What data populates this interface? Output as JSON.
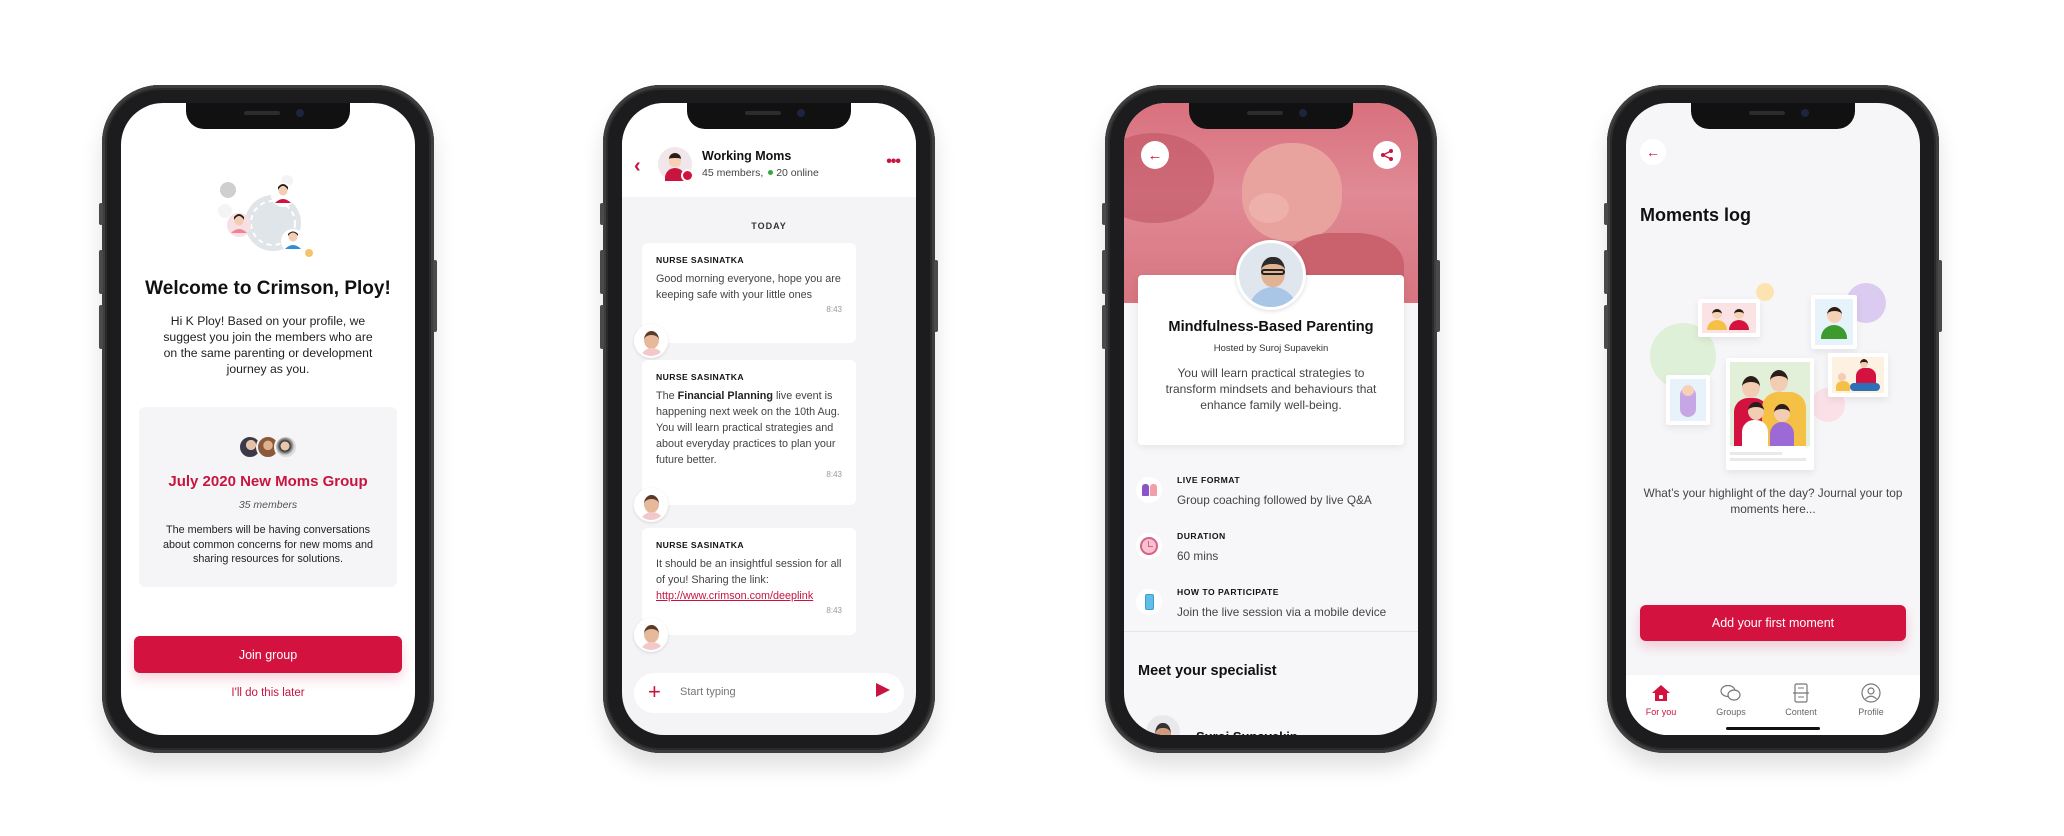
{
  "colors": {
    "accent": "#d3123f",
    "text_dark": "#111111",
    "text_body": "#444444",
    "screen_bg_light": "#f6f6f8",
    "online": "#3aa53a"
  },
  "phone1": {
    "title": "Welcome to Crimson, Ploy!",
    "subtitle": "Hi K Ploy! Based on your profile, we suggest you join the members who are on the same parenting or development journey as you.",
    "group_card": {
      "name": "July 2020 New Moms Group",
      "members": "35 members",
      "description": "The members will be having conversations about common concerns for new moms and sharing resources for solutions."
    },
    "join_button": "Join group",
    "later_link": "I'll do this later"
  },
  "phone2": {
    "group_name": "Working Moms",
    "members": "45 members,",
    "online": "20 online",
    "day_label": "TODAY",
    "messages": [
      {
        "sender": "NURSE SASINATKA",
        "text": "Good morning everyone, hope you are keeping safe with your little ones",
        "time": "8:43"
      },
      {
        "sender": "NURSE SASINATKA",
        "text_before": "The ",
        "text_bold": "Financial Planning",
        "text_after": " live event is happening next week on the 10th Aug. You will learn practical strategies and about everyday practices to plan your future better.",
        "time": "8:43"
      },
      {
        "sender": "NURSE SASINATKA",
        "text": "It should be an insightful session for all of you! Sharing the link:",
        "link": "http://www.crimson.com/deeplink",
        "time": "8:43"
      }
    ],
    "composer_placeholder": "Start typing",
    "icons": {
      "back": "chevron-left",
      "more": "more-horizontal",
      "add": "plus",
      "send": "send"
    }
  },
  "phone3": {
    "event_title": "Mindfulness-Based Parenting",
    "host": "Hosted by Suroj Supavekin",
    "description": "You will learn practical strategies to transform mindsets and behaviours that enhance family well-being.",
    "details": [
      {
        "icon": "people-icon",
        "label": "LIVE FORMAT",
        "value": "Group coaching followed by live Q&A"
      },
      {
        "icon": "clock-icon",
        "label": "DURATION",
        "value": "60 mins"
      },
      {
        "icon": "mobile-icon",
        "label": "HOW TO PARTICIPATE",
        "value": "Join the live session via a mobile device"
      }
    ],
    "section_title": "Meet your specialist",
    "specialist_name": "Suroj Supavekin",
    "icons": {
      "back": "arrow-left",
      "share": "share"
    }
  },
  "phone4": {
    "title": "Moments log",
    "description": "What’s your highlight of the day?  Journal your top moments here...",
    "add_button": "Add your first moment",
    "tabs": [
      {
        "label": "For you",
        "icon": "home-icon",
        "active": true
      },
      {
        "label": "Groups",
        "icon": "chat-bubbles-icon",
        "active": false
      },
      {
        "label": "Content",
        "icon": "document-icon",
        "active": false
      },
      {
        "label": "Profile",
        "icon": "user-circle-icon",
        "active": false
      }
    ]
  }
}
